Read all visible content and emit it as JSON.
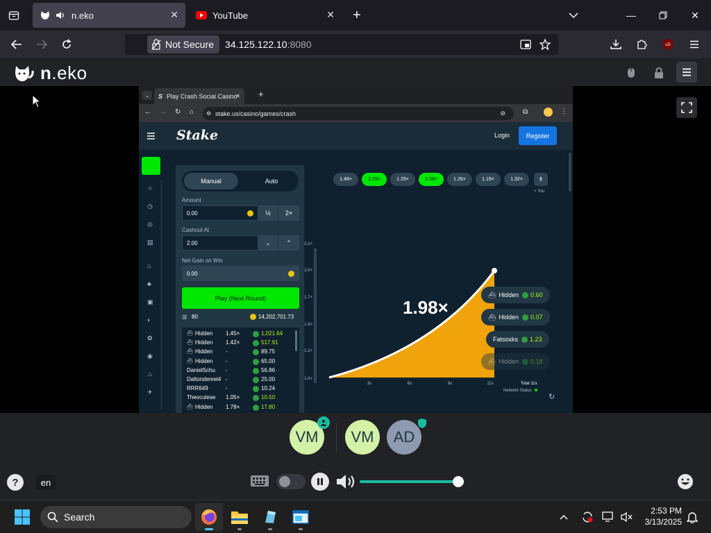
{
  "firefox": {
    "tabs": [
      {
        "title": "n.eko",
        "active": true
      },
      {
        "title": "YouTube",
        "active": false
      }
    ],
    "security_label": "Not Secure",
    "url_host": "34.125.122.10",
    "url_port": ":8080"
  },
  "neko": {
    "logo_bold": "n",
    "logo_rest": ".eko"
  },
  "remote": {
    "tab_title": "Play Crash Social Casino",
    "url": "stake.us/casino/games/crash",
    "stake": {
      "logo": "Stake",
      "login_label": "Login",
      "register_label": "Register",
      "mode_manual": "Manual",
      "mode_auto": "Auto",
      "amount_label": "Amount",
      "amount_value": "0.00",
      "half_label": "½",
      "double_label": "2×",
      "cashout_label": "Cashout At",
      "cashout_value": "2.00",
      "netgain_label": "Net Gain on Win",
      "netgain_value": "0.00",
      "play_label": "Play (Next Round)",
      "player_count": "80",
      "total_amount": "14,202,701.73",
      "players": [
        {
          "name": "Hidden",
          "mult": "1.45×",
          "amount": "1,021.64",
          "hidden": true,
          "highlight": true
        },
        {
          "name": "Hidden",
          "mult": "1.42×",
          "amount": "517.91",
          "hidden": true,
          "highlight": true
        },
        {
          "name": "Hidden",
          "mult": "-",
          "amount": "89.75",
          "hidden": true,
          "highlight": false
        },
        {
          "name": "Hidden",
          "mult": "-",
          "amount": "65.00",
          "hidden": true,
          "highlight": false
        },
        {
          "name": "DanielSchu",
          "mult": "-",
          "amount": "56.86",
          "hidden": false,
          "highlight": false
        },
        {
          "name": "Daltondemel4",
          "mult": "-",
          "amount": "25.00",
          "hidden": false,
          "highlight": false
        },
        {
          "name": "RRR649",
          "mult": "-",
          "amount": "10.24",
          "hidden": false,
          "highlight": false
        },
        {
          "name": "Theoculese",
          "mult": "1.05×",
          "amount": "10.50",
          "hidden": false,
          "highlight": true
        },
        {
          "name": "Hidden",
          "mult": "1.78×",
          "amount": "17.80",
          "hidden": true,
          "highlight": true
        }
      ],
      "history": [
        {
          "value": "1.48×",
          "green": false
        },
        {
          "value": "2.29×",
          "green": true
        },
        {
          "value": "1.29×",
          "green": false
        },
        {
          "value": "2.38×",
          "green": true
        },
        {
          "value": "1.26×",
          "green": false
        },
        {
          "value": "1.19×",
          "green": false
        },
        {
          "value": "1.32×",
          "green": false
        }
      ],
      "you_label": "+ You",
      "current_multiplier": "1.98×",
      "y_ticks": [
        "2.2×",
        "2.0×",
        "1.7×",
        "1.5×",
        "1.2×",
        "1.0×"
      ],
      "x_ticks": [
        "3s",
        "6s",
        "8s",
        "11s"
      ],
      "total_time": "Total 11s",
      "network_status": "Network Status",
      "cashout_pills": [
        {
          "name": "Hidden",
          "amount": "0.60",
          "faded": false
        },
        {
          "name": "Hidden",
          "amount": "0.07",
          "faded": false
        },
        {
          "name": "Fatsoxks",
          "amount": "1.23",
          "faded": false
        },
        {
          "name": "Hidden",
          "amount": "0.18",
          "faded": true
        }
      ]
    }
  },
  "call": {
    "participants": [
      "VM",
      "VM",
      "AD"
    ],
    "language": "en"
  },
  "taskbar": {
    "search_placeholder": "Search",
    "time": "2:53 PM",
    "date": "3/13/2025"
  },
  "colors": {
    "stake_green": "#00e701",
    "stake_bg": "#0f212e",
    "curve_fill": "#f0a30a",
    "avatar_vm": "#d3f1a7",
    "avatar_ad": "#8e9aaf",
    "register_blue": "#1475e1"
  }
}
